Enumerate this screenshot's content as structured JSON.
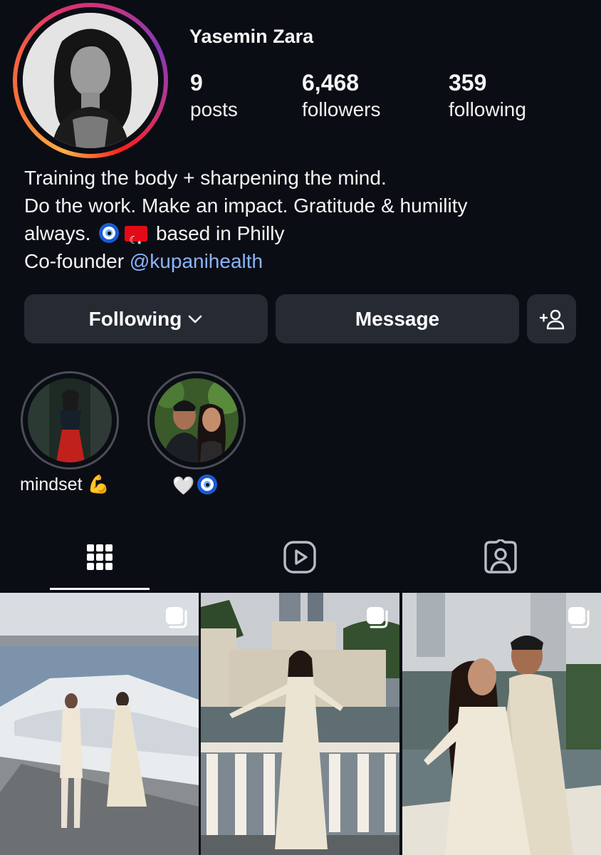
{
  "profile": {
    "username": "Yasemin Zara",
    "stats": [
      {
        "value": "9",
        "label": "posts"
      },
      {
        "value": "6,468",
        "label": "followers"
      },
      {
        "value": "359",
        "label": "following"
      }
    ],
    "bio": {
      "line1": "Training the body + sharpening the mind.",
      "line2": "Do the work. Make an impact. Gratitude & humility",
      "line3_start": "always.",
      "line3_end": "based in Philly",
      "line4_start": "Co-founder",
      "mention": "@kupanihealth"
    }
  },
  "actions": {
    "following_label": "Following",
    "message_label": "Message",
    "add_person_icon": "add-person-icon"
  },
  "highlights": [
    {
      "label": "mindset 💪"
    },
    {
      "label": "🤍"
    }
  ],
  "tabs": [
    "grid-icon",
    "reels-icon",
    "tagged-icon"
  ],
  "posts": [
    {
      "icon": "carousel-icon"
    },
    {
      "icon": "carousel-icon"
    },
    {
      "icon": "carousel-icon"
    }
  ],
  "colors": {
    "background": "#0b0d14",
    "button": "#262a33",
    "mention": "#8ab4ff"
  }
}
